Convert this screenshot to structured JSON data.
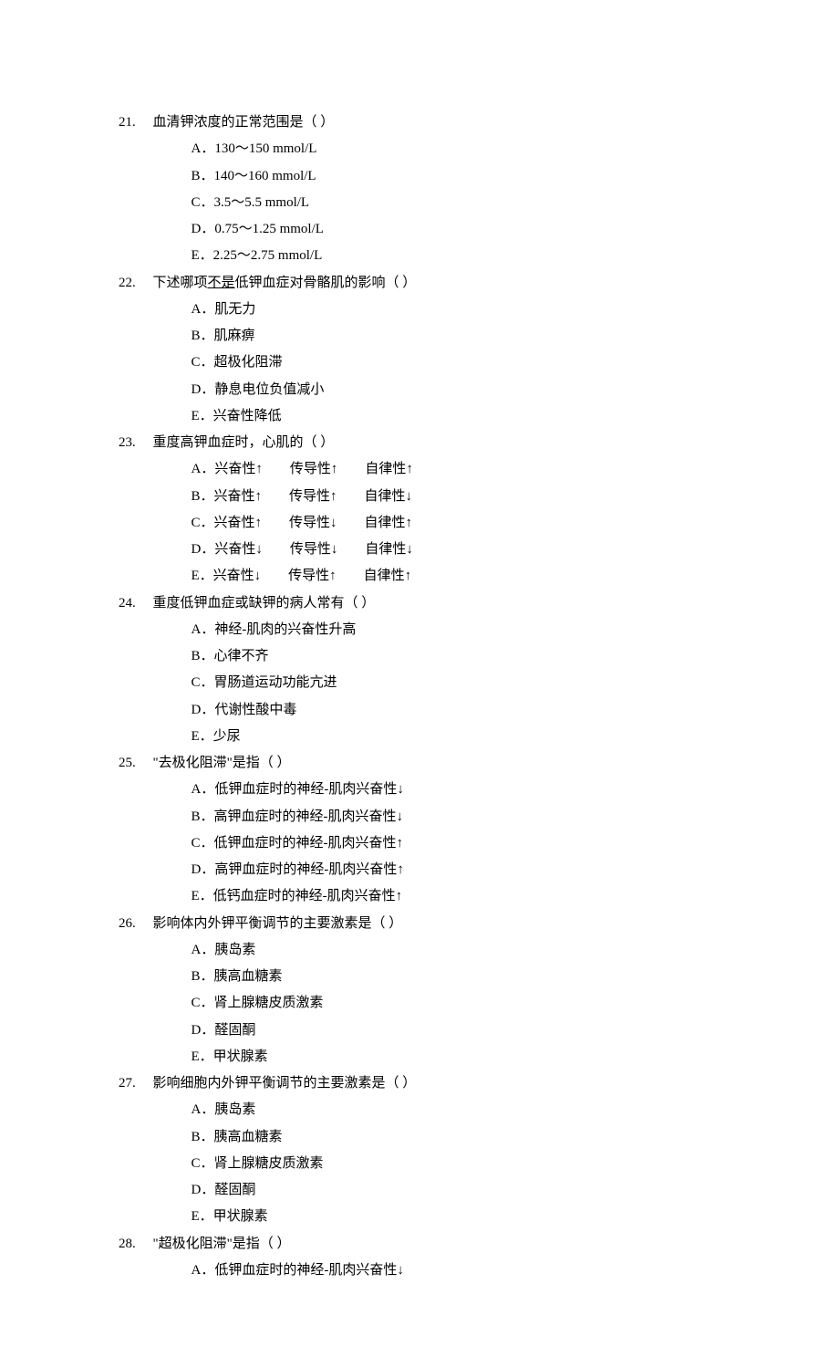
{
  "questions": [
    {
      "num": "21.",
      "stem": "血清钾浓度的正常范围是（ ）",
      "options": [
        {
          "letter": "A．",
          "text": "130～150 mmol/L"
        },
        {
          "letter": "B．",
          "text": "140～160 mmol/L"
        },
        {
          "letter": "C．",
          "text": "3.5～5.5 mmol/L"
        },
        {
          "letter": "D．",
          "text": "0.75～1.25 mmol/L"
        },
        {
          "letter": "E．",
          "text": "2.25～2.75 mmol/L"
        }
      ]
    },
    {
      "num": "22.",
      "stem_pre": "下述哪项",
      "stem_underline": "不是",
      "stem_post": "低钾血症对骨骼肌的影响（ ）",
      "options": [
        {
          "letter": "A．",
          "text": "肌无力"
        },
        {
          "letter": "B．",
          "text": "肌麻痹"
        },
        {
          "letter": "C．",
          "text": "超极化阻滞"
        },
        {
          "letter": "D．",
          "text": "静息电位负值减小"
        },
        {
          "letter": "E．",
          "text": "兴奋性降低"
        }
      ]
    },
    {
      "num": "23.",
      "stem": "重度高钾血症时，心肌的（ ）",
      "options": [
        {
          "letter": "A．",
          "text": "兴奋性↑　　传导性↑　　自律性↑"
        },
        {
          "letter": "B．",
          "text": "兴奋性↑　　传导性↑　　自律性↓"
        },
        {
          "letter": "C．",
          "text": "兴奋性↑　　传导性↓　　自律性↑"
        },
        {
          "letter": "D．",
          "text": "兴奋性↓　　传导性↓　　自律性↓"
        },
        {
          "letter": "E．",
          "text": "兴奋性↓　　传导性↑　　自律性↑"
        }
      ]
    },
    {
      "num": "24.",
      "stem": "重度低钾血症或缺钾的病人常有（ ）",
      "options": [
        {
          "letter": "A．",
          "text": "神经-肌肉的兴奋性升高"
        },
        {
          "letter": "B．",
          "text": "心律不齐"
        },
        {
          "letter": "C．",
          "text": "胃肠道运动功能亢进"
        },
        {
          "letter": "D．",
          "text": "代谢性酸中毒"
        },
        {
          "letter": "E．",
          "text": "少尿"
        }
      ]
    },
    {
      "num": "25.",
      "stem": "\"去极化阻滞\"是指（ ）",
      "options": [
        {
          "letter": "A．",
          "text": "低钾血症时的神经-肌肉兴奋性↓"
        },
        {
          "letter": "B．",
          "text": "高钾血症时的神经-肌肉兴奋性↓"
        },
        {
          "letter": "C．",
          "text": "低钾血症时的神经-肌肉兴奋性↑"
        },
        {
          "letter": "D．",
          "text": "高钾血症时的神经-肌肉兴奋性↑"
        },
        {
          "letter": "E．",
          "text": "低钙血症时的神经-肌肉兴奋性↑"
        }
      ]
    },
    {
      "num": "26.",
      "stem": "影响体内外钾平衡调节的主要激素是（ ）",
      "options": [
        {
          "letter": "A．",
          "text": "胰岛素"
        },
        {
          "letter": "B．",
          "text": "胰高血糖素"
        },
        {
          "letter": "C．",
          "text": "肾上腺糖皮质激素"
        },
        {
          "letter": "D．",
          "text": "醛固酮"
        },
        {
          "letter": "E．",
          "text": "甲状腺素"
        }
      ]
    },
    {
      "num": "27.",
      "stem": "影响细胞内外钾平衡调节的主要激素是（ ）",
      "options": [
        {
          "letter": "A．",
          "text": "胰岛素"
        },
        {
          "letter": "B．",
          "text": "胰高血糖素"
        },
        {
          "letter": "C．",
          "text": "肾上腺糖皮质激素"
        },
        {
          "letter": "D．",
          "text": "醛固酮"
        },
        {
          "letter": "E．",
          "text": "甲状腺素"
        }
      ]
    },
    {
      "num": "28.",
      "stem": "\"超极化阻滞\"是指（ ）",
      "options": [
        {
          "letter": "A．",
          "text": "低钾血症时的神经-肌肉兴奋性↓"
        }
      ]
    }
  ]
}
